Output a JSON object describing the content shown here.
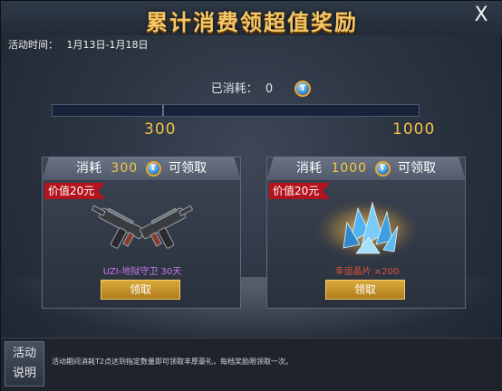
{
  "header": {
    "title": "累计消费领超值奖励",
    "close_label": "X"
  },
  "period": {
    "label": "活动时间：",
    "range": "1月13日-1月18日"
  },
  "consumed": {
    "label": "已消耗：",
    "value": "0",
    "icon": "t-coin-icon"
  },
  "progress": {
    "value": 0,
    "max": 1000
  },
  "milestones": [
    "300",
    "1000"
  ],
  "rewards": [
    {
      "head_prefix": "消耗",
      "amount": "300",
      "head_suffix": "可领取",
      "value_label": "价值20元",
      "item_name": "UZI-地狱守卫 30天",
      "claim_label": "领取",
      "icon": "dual-uzi-icon"
    },
    {
      "head_prefix": "消耗",
      "amount": "1000",
      "head_suffix": "可领取",
      "value_label": "价值20元",
      "item_name": "幸运晶片 ×200",
      "claim_label": "领取",
      "icon": "blue-crystal-icon"
    }
  ],
  "footer": {
    "button_label_1": "活动",
    "button_label_2": "说明",
    "description": "活动期间消耗T2点达到指定数量即可领取丰厚豪礼，每档奖励限领取一次。"
  },
  "colors": {
    "title": "#f4c768",
    "amount": "#f1c04a",
    "ribbon": "#b4141d",
    "claim": "#d9a93a"
  }
}
